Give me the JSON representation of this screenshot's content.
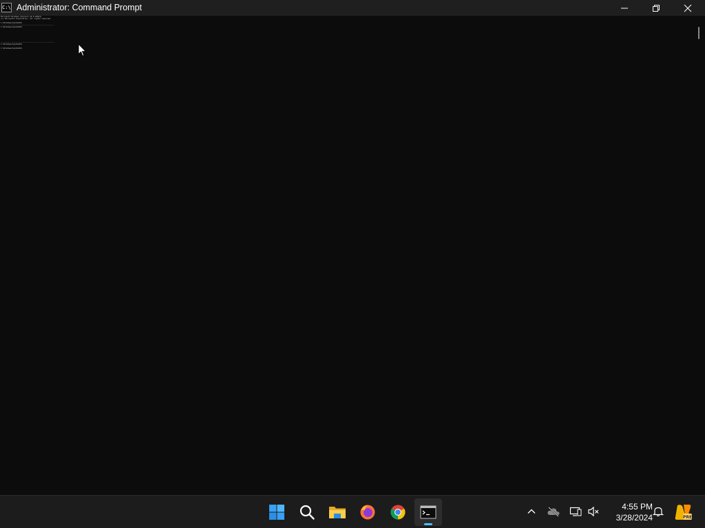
{
  "window": {
    "title": "Administrator: Command Prompt",
    "icon_label": "C:\\"
  },
  "console": {
    "lines": [
      "Microsoft Windows [Version 10.0.22631]",
      "(c) Microsoft Corporation. All rights reserved.",
      "",
      "C:\\Windows\\System32>",
      "--------------------------------------------------",
      "C:\\Windows\\System32>",
      "",
      "",
      "",
      "",
      "",
      "",
      "--------------------------------------------------",
      "C:\\Windows\\System32>",
      "",
      "C:\\Windows\\System32>"
    ]
  },
  "taskbar": {
    "apps": [
      {
        "name": "start",
        "icon": "windows-logo-icon"
      },
      {
        "name": "search",
        "icon": "search-icon"
      },
      {
        "name": "file-explorer",
        "icon": "folder-icon"
      },
      {
        "name": "firefox",
        "icon": "firefox-icon"
      },
      {
        "name": "chrome",
        "icon": "chrome-icon"
      },
      {
        "name": "command-prompt",
        "icon": "terminal-icon",
        "active": true
      }
    ],
    "tray": {
      "time": "4:55 PM",
      "date": "3/28/2024"
    }
  },
  "colors": {
    "console_bg": "#0c0c0c",
    "titlebar_bg": "#1f1f1f",
    "taskbar_bg": "#1c1c1c",
    "accent": "#4cc2ff"
  }
}
